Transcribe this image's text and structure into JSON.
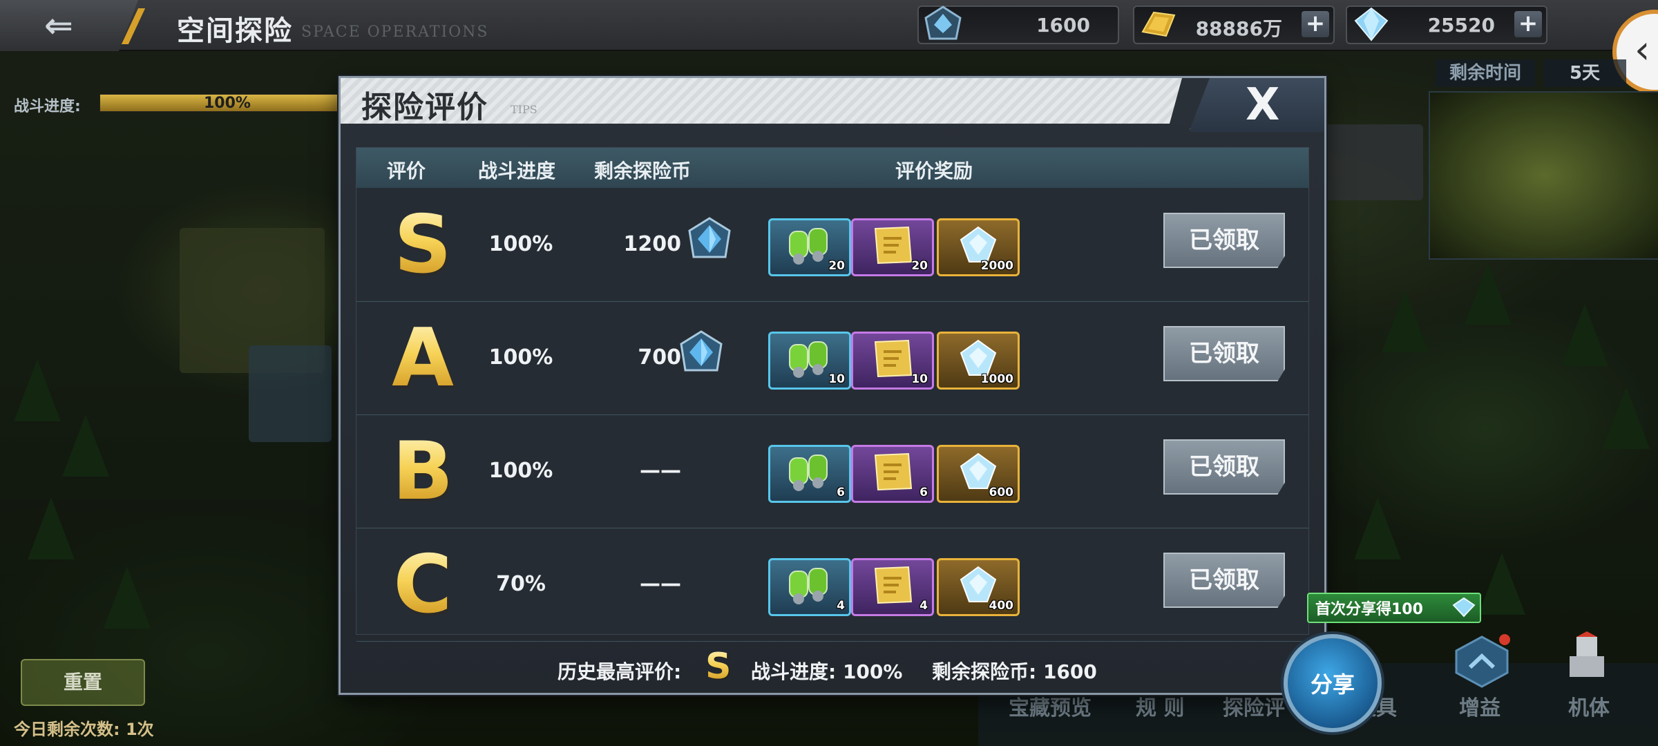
{
  "header": {
    "title": "空间探险",
    "subtitle": "SPACE OPERATIONS",
    "resources": [
      {
        "icon": "crystal-badge-icon",
        "value": "1600",
        "has_plus": false
      },
      {
        "icon": "gold-bar-icon",
        "value": "88886万",
        "has_plus": true,
        "plus": "+"
      },
      {
        "icon": "diamond-icon",
        "value": "25520",
        "has_plus": true,
        "plus": "+"
      }
    ]
  },
  "left_hud": {
    "progress_label": "战斗进度:",
    "progress_text": "100%",
    "progress_value": 1.0,
    "button_label": "重置",
    "remaining_count": "今日剩余次数: 1次"
  },
  "right_hud": {
    "time_label": "剩余时间",
    "time_value": "5天"
  },
  "bottom_menu": {
    "items": [
      "宝藏预览",
      "规 则",
      "探险评",
      "道具",
      "增益",
      "机体"
    ]
  },
  "modal": {
    "title": "探险评价",
    "tips": "TIPS",
    "close": "X",
    "columns": [
      "评价",
      "战斗进度",
      "剩余探险币",
      "评价奖励"
    ],
    "rows": [
      {
        "grade": "S",
        "progress": "100%",
        "coins": "1200",
        "show_coin_icon": true,
        "rewards": [
          {
            "type": "blue",
            "icon": "fuel-cells-icon",
            "count": "20"
          },
          {
            "type": "purple",
            "icon": "scroll-icon",
            "count": "20"
          },
          {
            "type": "gold",
            "icon": "crystal-icon",
            "count": "2000"
          }
        ],
        "button": "已领取"
      },
      {
        "grade": "A",
        "progress": "100%",
        "coins": "700",
        "show_coin_icon": true,
        "rewards": [
          {
            "type": "blue",
            "icon": "fuel-cells-icon",
            "count": "10"
          },
          {
            "type": "purple",
            "icon": "scroll-icon",
            "count": "10"
          },
          {
            "type": "gold",
            "icon": "crystal-icon",
            "count": "1000"
          }
        ],
        "button": "已领取"
      },
      {
        "grade": "B",
        "progress": "100%",
        "coins": "——",
        "show_coin_icon": false,
        "rewards": [
          {
            "type": "blue",
            "icon": "fuel-cells-icon",
            "count": "6"
          },
          {
            "type": "purple",
            "icon": "scroll-icon",
            "count": "6"
          },
          {
            "type": "gold",
            "icon": "crystal-icon",
            "count": "600"
          }
        ],
        "button": "已领取"
      },
      {
        "grade": "C",
        "progress": "70%",
        "coins": "——",
        "show_coin_icon": false,
        "rewards": [
          {
            "type": "blue",
            "icon": "fuel-cells-icon",
            "count": "4"
          },
          {
            "type": "purple",
            "icon": "scroll-icon",
            "count": "4"
          },
          {
            "type": "gold",
            "icon": "crystal-icon",
            "count": "400"
          }
        ],
        "button": "已领取"
      }
    ],
    "summary": {
      "best_label": "历史最高评价:",
      "best_grade": "S",
      "progress_label": "战斗进度: 100%",
      "coins_label": "剩余探险币: 1600"
    }
  },
  "share": {
    "tip": "首次分享得100",
    "button": "分享"
  },
  "colors": {
    "grade_gold": "#f3c84a",
    "claimed_button": "#7f8b96",
    "table_header": "#3e5966",
    "share_blue": "#2a86c8"
  }
}
